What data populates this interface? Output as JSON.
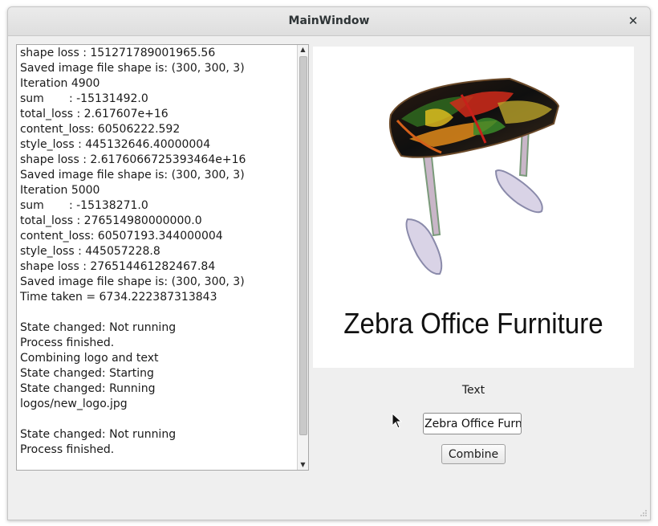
{
  "window": {
    "title": "MainWindow",
    "close_icon": "close-icon"
  },
  "log": {
    "lines": "shape loss : 151271789001965.56\nSaved image file shape is: (300, 300, 3)\nIteration 4900\nsum       : -15131492.0\ntotal_loss : 2.617607e+16\ncontent_loss: 60506222.592\nstyle_loss : 445132646.40000004\nshape loss : 2.6176066725393464e+16\nSaved image file shape is: (300, 300, 3)\nIteration 5000\nsum       : -15138271.0\ntotal_loss : 276514980000000.0\ncontent_loss: 60507193.344000004\nstyle_loss : 445057228.8\nshape loss : 276514461282467.84\nSaved image file shape is: (300, 300, 3)\nTime taken = 6734.222387313843\n\nState changed: Not running\nProcess finished.\nCombining logo and text\nState changed: Starting\nState changed: Running\nlogos/new_logo.jpg\n\nState changed: Not running\nProcess finished."
  },
  "preview": {
    "caption": "Zebra Office Furniture"
  },
  "controls": {
    "text_label": "Text",
    "text_value": "Zebra Office Furniture",
    "combine_label": "Combine"
  }
}
